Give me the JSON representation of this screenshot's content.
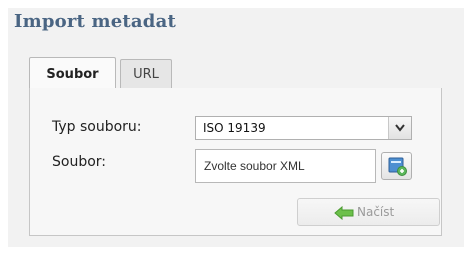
{
  "panel": {
    "title": "Import metadat"
  },
  "tabs": [
    {
      "label": "Soubor",
      "active": true
    },
    {
      "label": "URL",
      "active": false
    }
  ],
  "form": {
    "type_label": "Typ souboru:",
    "type_value": "ISO 19139",
    "file_label": "Soubor:",
    "file_placeholder": "Zvolte soubor XML",
    "load_label": "Načíst",
    "load_enabled": false
  },
  "icons": {
    "dropdown": "chevron-down-icon",
    "browse": "browse-file-icon",
    "load": "arrow-left-icon"
  },
  "colors": {
    "title": "#4a6583",
    "arrow": "#6cc04a",
    "disabled_text": "#9a9a9a"
  }
}
